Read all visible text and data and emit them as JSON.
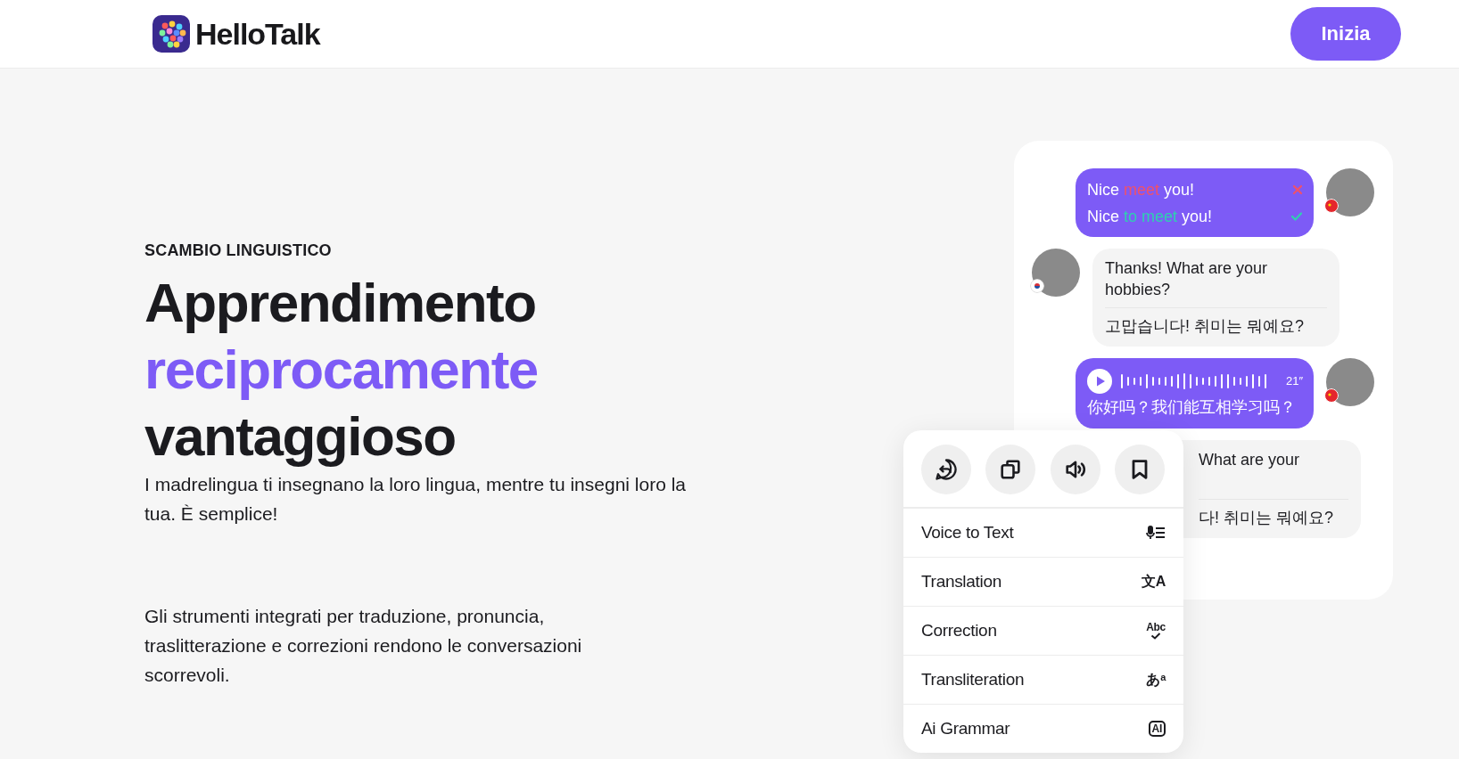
{
  "header": {
    "logo_text": "HelloTalk",
    "cta": "Inizia"
  },
  "hero": {
    "eyebrow": "SCAMBIO LINGUISTICO",
    "title_lines": [
      {
        "text": "Apprendimento",
        "accent": false
      },
      {
        "text": "reciprocamente",
        "accent": true
      },
      {
        "text": "vantaggioso",
        "accent": false
      }
    ],
    "lead": "I madrelingua ti insegnano la loro lingua, mentre tu insegni loro la tua. È semplice!",
    "body": "Gli strumenti integrati per traduzione, pronuncia, traslitterazione e correzioni rendono le conversazioni scorrevoli."
  },
  "chat": {
    "messages": [
      {
        "kind": "correction",
        "avatar": true,
        "lines": [
          {
            "kind": "wrong",
            "parts": [
              "Nice ",
              "meet",
              " you!"
            ]
          },
          {
            "kind": "right",
            "parts": [
              "Nice ",
              "to meet",
              " you!"
            ]
          }
        ]
      },
      {
        "kind": "text",
        "avatar": true,
        "text": "Thanks! What are your hobbies?",
        "translation": "고맙습니다! 취미는 뭐예요?"
      },
      {
        "kind": "voice",
        "avatar": true,
        "duration": "21″",
        "transcript": "你好吗？我们能互相学习吗？"
      },
      {
        "kind": "text",
        "avatar": false,
        "text": "What are your",
        "translation": "다! 취미는 뭐예요?"
      }
    ]
  },
  "menu": {
    "items": [
      {
        "label": "Voice to Text",
        "icon": {
          "kind": "mic"
        }
      },
      {
        "label": "Translation",
        "icon": {
          "kind": "glyph",
          "text": "文A"
        }
      },
      {
        "label": "Correction",
        "icon": {
          "kind": "check",
          "text": "Abc"
        }
      },
      {
        "label": "Transliteration",
        "icon": {
          "kind": "glyph",
          "text": "あ$^{a}$"
        }
      },
      {
        "label": "Ai Grammar",
        "icon": {
          "kind": "boxed",
          "text": "AI"
        }
      }
    ]
  }
}
